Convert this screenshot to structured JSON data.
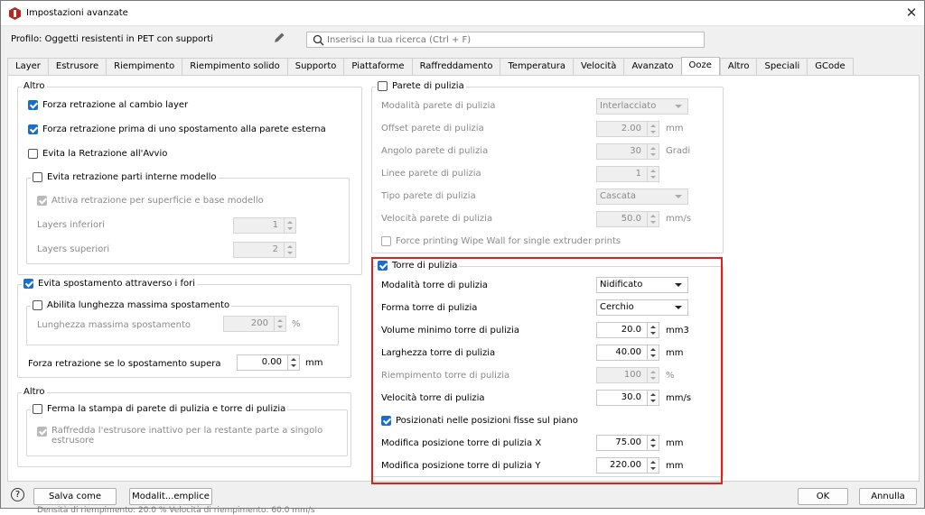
{
  "window": {
    "title": "Impostazioni avanzate",
    "close": "✕"
  },
  "profile": {
    "label": "Profilo: Oggetti resistenti in PET con supporti"
  },
  "search": {
    "placeholder": "Inserisci la tua ricerca (Ctrl + F)"
  },
  "tabs": [
    "Layer",
    "Estrusore",
    "Riempimento",
    "Riempimento solido",
    "Supporto",
    "Piattaforme",
    "Raffreddamento",
    "Temperatura",
    "Velocità",
    "Avanzato",
    "Ooze",
    "Altro",
    "Speciali",
    "GCode"
  ],
  "active_tab": "Ooze",
  "left": {
    "g1": {
      "title": "Altro",
      "c1": "Forza retrazione al cambio layer",
      "c2": "Forza retrazione prima di uno spostamento alla parete esterna",
      "c3": "Evita la Retrazione all'Avvio",
      "sub": {
        "title": "Evita retrazione parti interne modello",
        "c1": "Attiva retrazione per superficie e base modello",
        "f1": "Layers inferiori",
        "v1": "1",
        "f2": "Layers superiori",
        "v2": "2"
      }
    },
    "g2": {
      "title": "Evita spostamento attraverso i fori",
      "sub": {
        "title": "Abilita lunghezza massima spostamento",
        "f1": "Lunghezza massima spostamento",
        "v1": "200",
        "u1": "%"
      },
      "f2": "Forza retrazione se lo spostamento supera",
      "v2": "0.00",
      "u2": "mm"
    },
    "g3": {
      "title": "Altro",
      "sub": {
        "title": "Ferma la stampa di parete di pulizia e torre di pulizia",
        "c1_line1": "Raffredda l'estrusore inattivo per la restante parte a singolo",
        "c1_line2": "estrusore"
      }
    }
  },
  "wall": {
    "title": "Parete di pulizia",
    "rows": [
      {
        "label": "Modalità parete di pulizia",
        "value": "Interlacciato",
        "unit": ""
      },
      {
        "label": "Offset parete di pulizia",
        "value": "2.00",
        "unit": "mm"
      },
      {
        "label": "Angolo parete di pulizia",
        "value": "30",
        "unit": "Gradi"
      },
      {
        "label": "Linee parete di pulizia",
        "value": "1",
        "unit": ""
      },
      {
        "label": "Tipo parete di pulizia",
        "value": "Cascata",
        "unit": ""
      },
      {
        "label": "Velocità parete di pulizia",
        "value": "50.0",
        "unit": "mm/s"
      }
    ],
    "force": "Force printing Wipe Wall for single extruder prints"
  },
  "tower": {
    "title": "Torre di pulizia",
    "rows": [
      {
        "label": "Modalità torre di pulizia",
        "value": "Nidificato",
        "unit": ""
      },
      {
        "label": "Forma torre di pulizia",
        "value": "Cerchio",
        "unit": ""
      },
      {
        "label": "Volume minimo torre di pulizia",
        "value": "20.0",
        "unit": "mm3"
      },
      {
        "label": "Larghezza torre di pulizia",
        "value": "40.00",
        "unit": "mm"
      },
      {
        "label": "Riempimento torre di pulizia",
        "value": "100",
        "unit": "%"
      },
      {
        "label": "Velocità torre di pulizia",
        "value": "30.0",
        "unit": "mm/s"
      }
    ],
    "fixed": "Posizionati nelle posizioni fisse sul piano",
    "px": {
      "label": "Modifica posizione torre di pulizia X",
      "value": "75.00",
      "unit": "mm"
    },
    "py": {
      "label": "Modifica posizione torre di pulizia Y",
      "value": "220.00",
      "unit": "mm"
    }
  },
  "footer": {
    "help": "?",
    "save": "Salva come",
    "mode": "Modalit...emplice",
    "ok": "OK",
    "cancel": "Annulla"
  },
  "background": {
    "text": "Densità di riempimento: 20.0 %          Velocità di riempimento: 60.0 mm/s"
  },
  "colors": {
    "accent": "#1b6fc9",
    "highlight": "#e0221c"
  }
}
